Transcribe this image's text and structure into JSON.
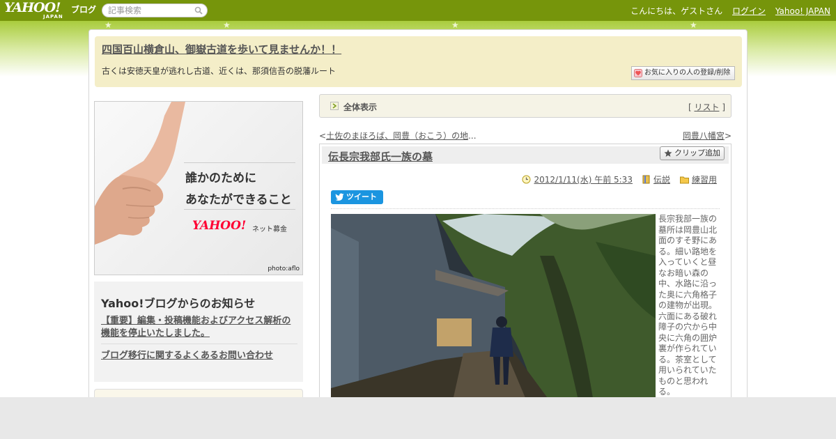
{
  "header": {
    "logo_main": "YAHOO!",
    "logo_sub": "JAPAN",
    "logo_blog": "ブログ",
    "search_placeholder": "記事検索",
    "greeting": "こんにちは、ゲストさん",
    "login_label": "ログイン",
    "yahoo_japan_label": "Yahoo! JAPAN"
  },
  "blog": {
    "title": "四国百山横倉山、御嶽古道を歩いて見ませんか！！",
    "description": "古くは安徳天皇が逃れし古道、近くは、那須信吾の脱藩ルート",
    "favorite_button": "お気に入りの人の登録/削除"
  },
  "ad": {
    "line1": "誰かのために",
    "line2": "あなたができること",
    "logo": "YAHOO!",
    "subtitle": "ネット募金",
    "credit": "photo:aflo"
  },
  "notice": {
    "heading": "Yahoo!ブログからのお知らせ",
    "link1": "【重要】編集・投稿機能およびアクセス解析の機能を停止いたしました。",
    "link2": "ブログ移行に関するよくあるお問い合わせ"
  },
  "view_bar": {
    "label": "全体表示",
    "list_open": "[",
    "list_link": "リスト",
    "list_close": "]"
  },
  "nav": {
    "prev_symbol": "<",
    "prev_link": "土佐のまほろば、岡豊（おこう）の地",
    "prev_ellipsis": "...",
    "next_link": "岡豊八幡宮",
    "next_symbol": ">"
  },
  "article": {
    "title": "伝長宗我部氏一族の墓",
    "clip_button": "クリップ追加",
    "date": "2012/1/11(水) 午前 5:33",
    "category1": "伝説",
    "category2": "練習用",
    "tweet_label": "ツイート",
    "body": "長宗我部一族の墓所は岡豊山北面のすそ野にある。細い路地を入っていくと昼なお暗い森の中、水路に沿った奥に六角格子の建物が出現。六面にある破れ障子の穴から中央に六角の囲炉裏が作られている。茶室として用いられていたものと思われる。"
  }
}
